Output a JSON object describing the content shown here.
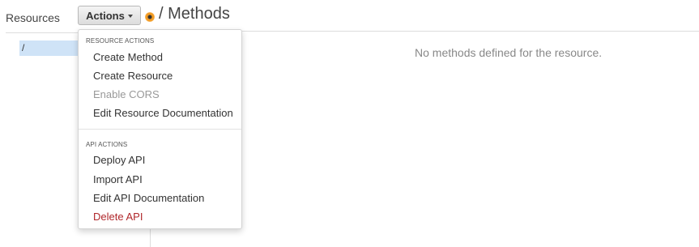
{
  "sidebar": {
    "title": "Resources",
    "tree": [
      "/"
    ]
  },
  "header": {
    "actions_label": "Actions",
    "title": "/ Methods"
  },
  "main": {
    "empty_message": "No methods defined for the resource."
  },
  "dropdown": {
    "resource_header": "RESOURCE ACTIONS",
    "resource_items": [
      {
        "label": "Create Method",
        "state": "enabled"
      },
      {
        "label": "Create Resource",
        "state": "enabled"
      },
      {
        "label": "Enable CORS",
        "state": "disabled"
      },
      {
        "label": "Edit Resource Documentation",
        "state": "enabled"
      }
    ],
    "api_header": "API ACTIONS",
    "api_items": [
      {
        "label": "Deploy API",
        "state": "enabled"
      },
      {
        "label": "Import API",
        "state": "enabled"
      },
      {
        "label": "Edit API Documentation",
        "state": "enabled"
      },
      {
        "label": "Delete API",
        "state": "danger"
      }
    ]
  },
  "colors": {
    "danger": "#b0272b",
    "disabled": "#999999",
    "selected": "#cfe3f7",
    "indicator": "#f39c24"
  },
  "icons": [
    "chevron-down-icon",
    "status-indicator-icon"
  ]
}
